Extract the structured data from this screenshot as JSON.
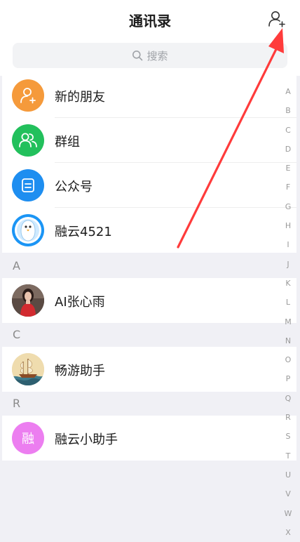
{
  "header": {
    "title": "通讯录"
  },
  "search": {
    "placeholder": "搜索"
  },
  "top_items": [
    {
      "label": "新的朋友",
      "color": "#f59a3b",
      "icon": "add-friend-icon"
    },
    {
      "label": "群组",
      "color": "#22c05c",
      "icon": "group-icon"
    },
    {
      "label": "公众号",
      "color": "#1e8ef0",
      "icon": "official-account-icon"
    },
    {
      "label": "融云4521",
      "color": "#1b95f5",
      "icon": "penguin-avatar-icon"
    }
  ],
  "sections": [
    {
      "letter": "A",
      "contacts": [
        {
          "name": "AI张心雨",
          "avatar": "photo-avatar"
        }
      ]
    },
    {
      "letter": "C",
      "contacts": [
        {
          "name": "畅游助手",
          "avatar": "sailing-ship-avatar"
        }
      ]
    },
    {
      "letter": "R",
      "contacts": [
        {
          "name": "融云小助手",
          "avatar_text": "融",
          "avatar_color": "#ec7ef0"
        }
      ]
    }
  ],
  "index_letters": [
    "A",
    "B",
    "C",
    "D",
    "E",
    "F",
    "G",
    "H",
    "I",
    "J",
    "K",
    "L",
    "M",
    "N",
    "O",
    "P",
    "Q",
    "R",
    "S",
    "T",
    "U",
    "V",
    "W",
    "X"
  ],
  "annotation": {
    "arrow_color": "#ff3b3b"
  }
}
